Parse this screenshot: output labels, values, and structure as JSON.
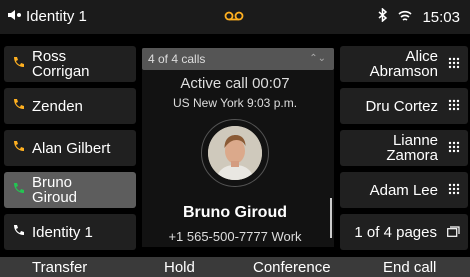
{
  "status": {
    "line_label": "Identity 1",
    "time": "15:03",
    "icons": [
      "speaker-out-icon",
      "voicemail-icon",
      "bluetooth-icon",
      "wifi-icon"
    ]
  },
  "left_keys": [
    {
      "lines": [
        "Ross",
        "Corrigan"
      ],
      "icon": "phone-handset-icon"
    },
    {
      "lines": [
        "Zenden"
      ],
      "icon": "phone-handset-icon"
    },
    {
      "lines": [
        "Alan Gilbert"
      ],
      "icon": "phone-handset-icon"
    },
    {
      "lines": [
        "Bruno",
        "Giroud"
      ],
      "icon": "phone-handset-icon",
      "selected": true
    },
    {
      "lines": [
        "Identity 1"
      ],
      "icon": "phone-handset-icon"
    }
  ],
  "right_keys": [
    {
      "lines": [
        "Alice",
        "Abramson"
      ],
      "icon": "dialpad-icon"
    },
    {
      "lines": [
        "Dru Cortez"
      ],
      "icon": "dialpad-icon"
    },
    {
      "lines": [
        "Lianne",
        "Zamora"
      ],
      "icon": "dialpad-icon"
    },
    {
      "lines": [
        "Adam Lee"
      ],
      "icon": "dialpad-icon"
    },
    {
      "lines": [
        "1 of 4 pages"
      ],
      "icon": "pages-icon"
    }
  ],
  "call": {
    "calls_count": "4 of 4 calls",
    "active": "Active call 00:07",
    "location_time": "US New York 9:03 p.m.",
    "name": "Bruno Giroud",
    "number": "+1 565-500-7777 Work"
  },
  "softkeys": [
    "Transfer",
    "Hold",
    "Conference",
    "End call"
  ],
  "colors": {
    "orange": "#ffb020",
    "green": "#23c552",
    "selected": "#5d5d5d",
    "key_bg": "#202020"
  }
}
